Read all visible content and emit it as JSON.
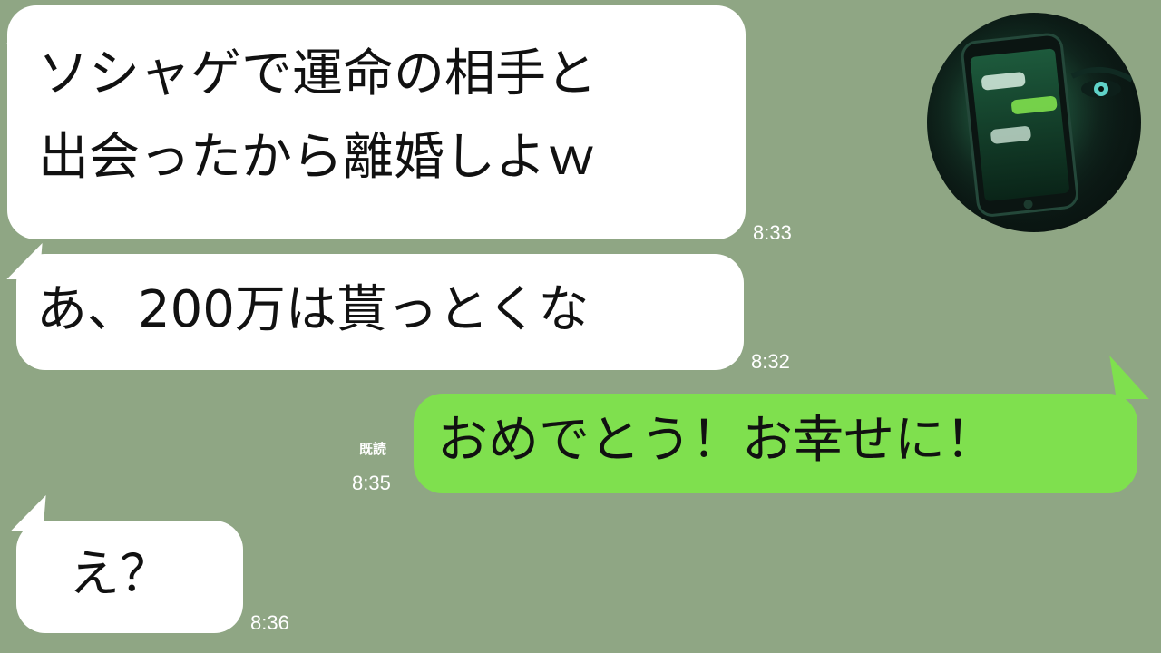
{
  "messages": [
    {
      "side": "received",
      "lines": [
        "ソシャゲで運命の相手と",
        "出会ったから離婚しよｗ"
      ],
      "time": "8:33"
    },
    {
      "side": "received",
      "lines": [
        "あ、200万は貰っとくな"
      ],
      "time": "8:32"
    },
    {
      "side": "sent",
      "lines": [
        "おめでとう！お幸せに！"
      ],
      "read_label": "既読",
      "time": "8:35"
    },
    {
      "side": "received",
      "lines": [
        "え？"
      ],
      "time": "8:36"
    }
  ],
  "avatar": {
    "icon": "smartphone-chat-icon"
  },
  "colors": {
    "background": "#8fa684",
    "received_bubble": "#ffffff",
    "sent_bubble": "#7fe04e"
  }
}
